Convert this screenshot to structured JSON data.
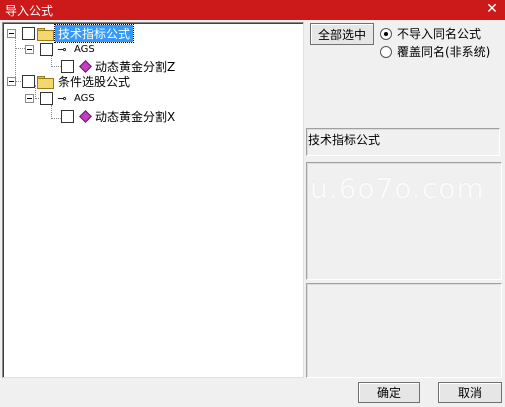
{
  "window": {
    "title": "导入公式",
    "close_glyph": "✕"
  },
  "tree": {
    "nodes": [
      {
        "label": "技术指标公式",
        "selected": true
      },
      {
        "label": "AGS"
      },
      {
        "label": "动态黄金分割Z"
      },
      {
        "label": "条件选股公式"
      },
      {
        "label": "AGS"
      },
      {
        "label": "动态黄金分割X"
      }
    ]
  },
  "options": {
    "select_all_label": "全部选中",
    "radios": [
      {
        "label": "不导入同名公式",
        "checked": true
      },
      {
        "label": "覆盖同名(非系统)",
        "checked": false
      }
    ]
  },
  "info": {
    "category_text": "技术指标公式"
  },
  "watermark": "u.6o7o.com",
  "footer": {
    "ok_label": "确定",
    "cancel_label": "取消"
  }
}
